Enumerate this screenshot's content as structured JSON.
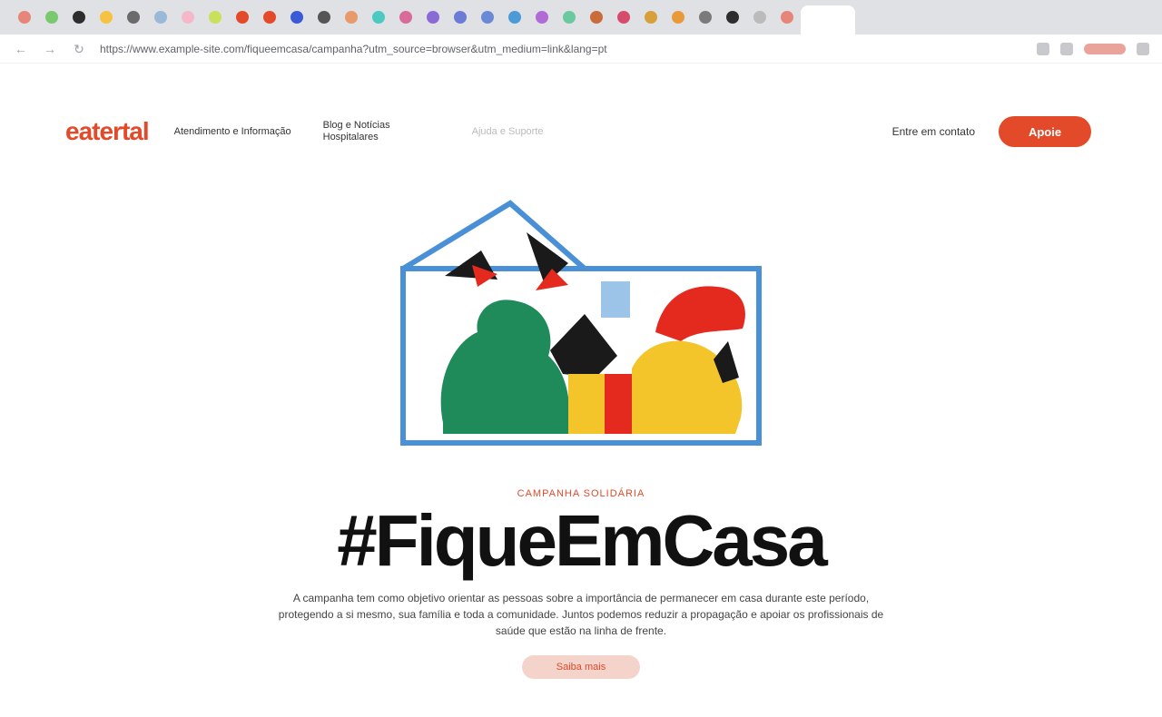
{
  "browser": {
    "favicon_colors": [
      "#e8857a",
      "#7bc96f",
      "#2d2d2d",
      "#f5c242",
      "#6b6b6b",
      "#9ab8d8",
      "#f5b8c8",
      "#c8e05a",
      "#e24a2a",
      "#e24a2a",
      "#3b5bd6",
      "#555555",
      "#e89a6a",
      "#4cc9c0",
      "#d86b9a",
      "#8a6bd6",
      "#6b7bd6",
      "#6b8ad6",
      "#4c9ad6",
      "#b06bd6",
      "#6bc9a0",
      "#c96b3a",
      "#d64c6b",
      "#d6a03a",
      "#e89a3a",
      "#7a7a7a",
      "#2d2d2d",
      "#bbbbbb",
      "#e8857a"
    ],
    "url": "https://www.example-site.com/fiqueemcasa/campanha?utm_source=browser&utm_medium=link&lang=pt",
    "back_icon": "arrow-left-icon",
    "forward_icon": "arrow-right-icon",
    "reload_icon": "reload-icon"
  },
  "header": {
    "logo": "eatertal",
    "nav": [
      {
        "label": "Atendimento e Informação"
      },
      {
        "label": "Blog e Notícias Hospitalares"
      },
      {
        "label": "Ajuda e Suporte"
      }
    ],
    "link": "Entre em contato",
    "cta": "Apoie"
  },
  "hero": {
    "eyebrow": "CAMPANHA SOLIDÁRIA",
    "title": "#FiqueEmCasa",
    "body": "A campanha tem como objetivo orientar as pessoas sobre a importância de permanecer em casa durante este período, protegendo a si mesmo, sua família e toda a comunidade. Juntos podemos reduzir a propagação e apoiar os profissionais de saúde que estão na linha de frente.",
    "button": "Saiba mais"
  },
  "colors": {
    "brand": "#e24a2a",
    "house_outline": "#4a90d6",
    "green": "#1f8a5a",
    "yellow": "#f3c52a",
    "red": "#e42a1f"
  }
}
